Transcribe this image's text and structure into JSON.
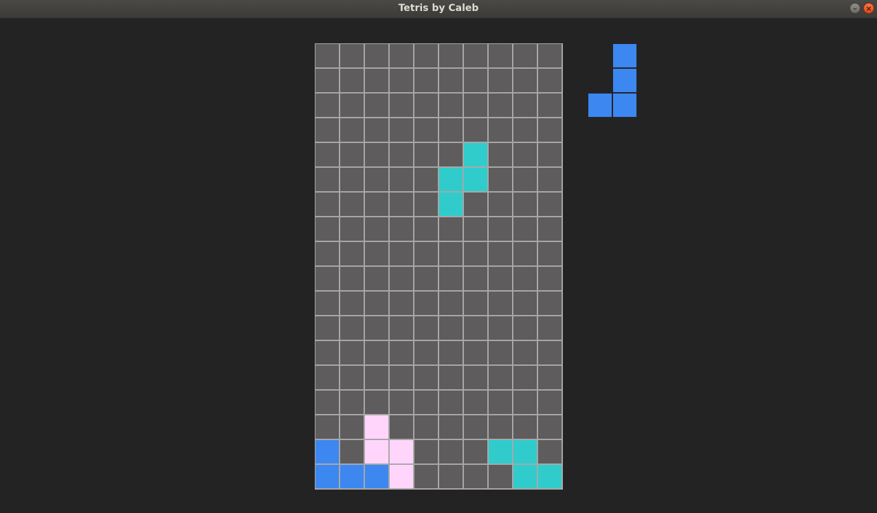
{
  "window": {
    "title": "Tetris by Caleb",
    "minimize_glyph": "–",
    "close_glyph": "×",
    "minimize_icon": "minimize-icon",
    "close_icon": "close-icon"
  },
  "colors": {
    "background": "#232323",
    "empty": "#5e5c5c",
    "gridline": "#a8a8a8",
    "B": "#3d87f0",
    "C": "#30cccc",
    "P": "#ffd5fb"
  },
  "board": {
    "columns": 10,
    "rows": 18,
    "grid": [
      "..........",
      "..........",
      "..........",
      "..........",
      "......C...",
      ".....CC...",
      ".....C....",
      "..........",
      "..........",
      "..........",
      "..........",
      "..........",
      "..........",
      "..........",
      "..........",
      "..P.......",
      "B.PP...CC.",
      "BBBP....CC"
    ]
  },
  "next_piece": {
    "name": "J",
    "grid": [
      ".B",
      ".B",
      "BB"
    ]
  }
}
